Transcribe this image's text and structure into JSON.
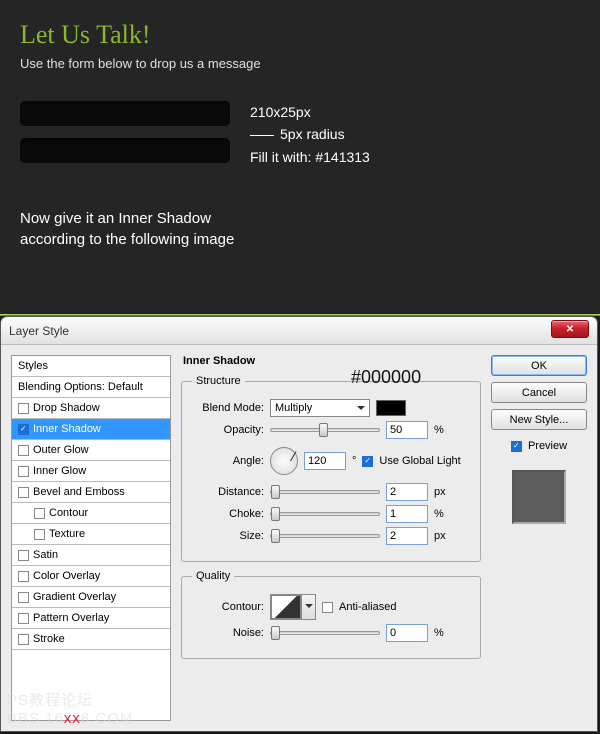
{
  "header": {
    "title": "Let Us Talk!",
    "subtitle": "Use the form below to drop us a message"
  },
  "specs": {
    "dims": "210x25px",
    "radius": "5px radius",
    "fill": "Fill it with: #141313"
  },
  "instruction": "Now give it an Inner Shadow\naccording to the following image",
  "dialog": {
    "title": "Layer Style",
    "hex_note": "#000000",
    "styles": {
      "head": "Styles",
      "blend_head": "Blending Options: Default",
      "items": [
        "Drop Shadow",
        "Inner Shadow",
        "Outer Glow",
        "Inner Glow",
        "Bevel and Emboss",
        "Contour",
        "Texture",
        "Satin",
        "Color Overlay",
        "Gradient Overlay",
        "Pattern Overlay",
        "Stroke"
      ]
    },
    "panel": {
      "title": "Inner Shadow",
      "structure_legend": "Structure",
      "blend_label": "Blend Mode:",
      "blend_value": "Multiply",
      "opacity_label": "Opacity:",
      "opacity_value": "50",
      "angle_label": "Angle:",
      "angle_value": "120",
      "angle_unit": "°",
      "ugl_label": "Use Global Light",
      "distance_label": "Distance:",
      "distance_value": "2",
      "choke_label": "Choke:",
      "choke_value": "1",
      "size_label": "Size:",
      "size_value": "2",
      "px": "px",
      "pct": "%",
      "quality_legend": "Quality",
      "contour_label": "Contour:",
      "aa_label": "Anti-aliased",
      "noise_label": "Noise:",
      "noise_value": "0"
    },
    "buttons": {
      "ok": "OK",
      "cancel": "Cancel",
      "new_style": "New Style...",
      "preview": "Preview"
    }
  },
  "watermark": {
    "a": "PS教程论坛",
    "b": "BBS.16",
    "c": "xx",
    "d": "8.COM"
  }
}
